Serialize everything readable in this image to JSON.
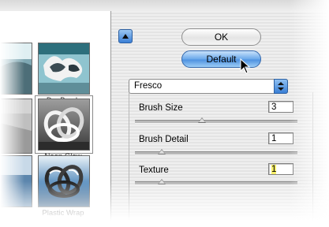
{
  "thumbnails": [
    {
      "label": "Dry Brush",
      "icon": "dry-brush-thumbnail"
    },
    {
      "label": "Neon Glow",
      "icon": "neon-glow-thumbnail"
    },
    {
      "label": "Plastic Wrap",
      "icon": "plastic-wrap-thumbnail"
    }
  ],
  "buttons": {
    "ok_label": "OK",
    "default_label": "Default",
    "collapse_icon": "triangle-up-icon"
  },
  "filter_select": {
    "selected": "Fresco"
  },
  "parameters": [
    {
      "label": "Brush Size",
      "value": "3",
      "slider_fraction": 0.3
    },
    {
      "label": "Brush Detail",
      "value": "1",
      "slider_fraction": 0.0
    },
    {
      "label": "Texture",
      "value": "1",
      "slider_fraction": 0.0
    }
  ],
  "colors": {
    "accent_blue": "#4e92e0",
    "highlight_yellow": "#f7ef6a",
    "panel_stripe_light": "#efefef",
    "panel_stripe_dark": "#e4e4e4"
  }
}
